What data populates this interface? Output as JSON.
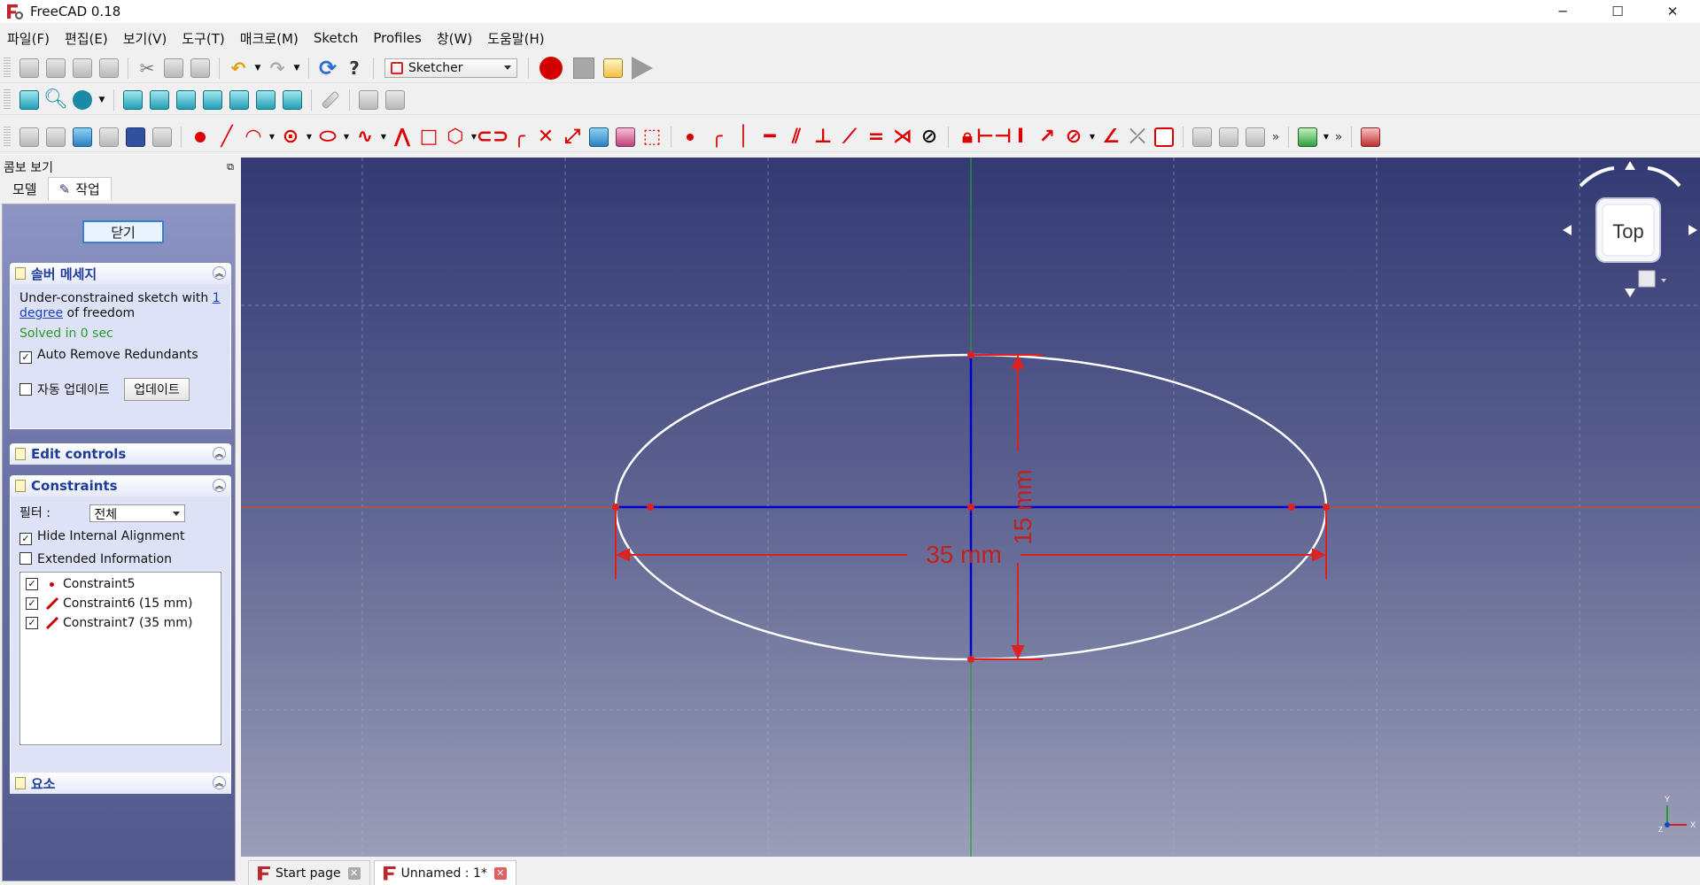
{
  "window": {
    "title": "FreeCAD 0.18",
    "minimize": "─",
    "maximize": "☐",
    "close": "✕"
  },
  "menu": [
    "파일(F)",
    "편집(E)",
    "보기(V)",
    "도구(T)",
    "매크로(M)",
    "Sketch",
    "Profiles",
    "창(W)",
    "도움말(H)"
  ],
  "toolbar": {
    "workbench": "Sketcher",
    "more": "»"
  },
  "combo": {
    "title": "콤보 보기",
    "tabs": [
      "모델",
      "작업"
    ],
    "close_button": "닫기",
    "solver": {
      "title": "솔버 메세지",
      "message_pre": "Under-constrained sketch with ",
      "message_link": "1 degree",
      "message_post": " of freedom",
      "solved": "Solved in 0 sec",
      "auto_remove": "Auto Remove Redundants",
      "auto_update": "자동 업데이트",
      "update_button": "업데이트"
    },
    "edit_controls": {
      "title": "Edit controls"
    },
    "constraints": {
      "title": "Constraints",
      "filter_label": "필터 :",
      "filter_value": "전체",
      "hide_internal": "Hide Internal Alignment",
      "extended_info": "Extended Information",
      "items": [
        {
          "name": "Constraint5",
          "checked": true,
          "type": "point"
        },
        {
          "name": "Constraint6 (15 mm)",
          "checked": true,
          "type": "distance"
        },
        {
          "name": "Constraint7 (35 mm)",
          "checked": true,
          "type": "distance"
        }
      ]
    },
    "elements": {
      "title": "요소"
    }
  },
  "viewport": {
    "navcube_face": "Top",
    "dim_vertical": "15 mm",
    "dim_horizontal": "35 mm",
    "axis_y": "Y",
    "axis_x": "X",
    "axis_z": "Z"
  },
  "doc_tabs": [
    {
      "label": "Start page",
      "active": false
    },
    {
      "label": "Unnamed : 1*",
      "active": true
    }
  ],
  "colors": {
    "sketch_line": "#ffffff",
    "construction": "#0000d0",
    "constraint": "#e02020",
    "axis_x": "#d04a2a",
    "axis_y": "#2a9a2a"
  }
}
